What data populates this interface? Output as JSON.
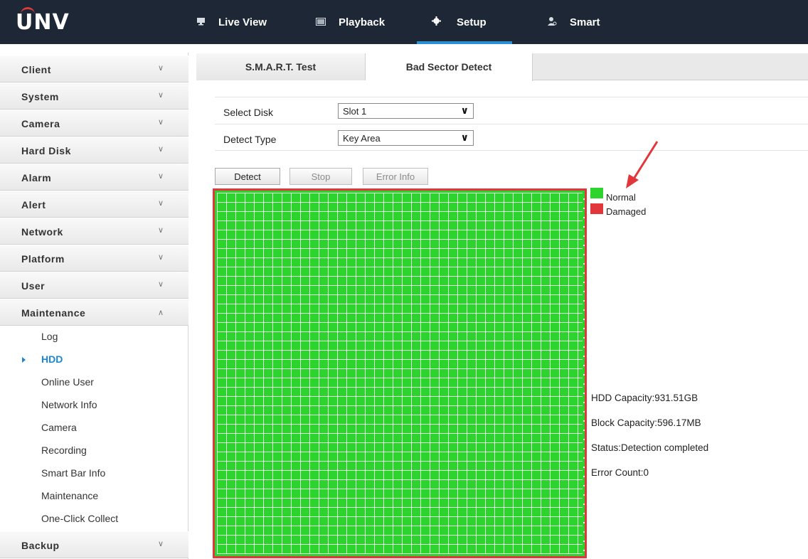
{
  "brand": {
    "logo": "UNV"
  },
  "nav": [
    {
      "icon": "monitor-icon",
      "label": "Live View"
    },
    {
      "icon": "film-icon",
      "label": "Playback"
    },
    {
      "icon": "gear-icon",
      "label": "Setup",
      "active": true
    },
    {
      "icon": "user-icon",
      "label": "Smart"
    }
  ],
  "sidebar": {
    "menus": [
      {
        "label": "Client"
      },
      {
        "label": "System"
      },
      {
        "label": "Camera"
      },
      {
        "label": "Hard Disk"
      },
      {
        "label": "Alarm"
      },
      {
        "label": "Alert"
      },
      {
        "label": "Network"
      },
      {
        "label": "Platform"
      },
      {
        "label": "User"
      },
      {
        "label": "Maintenance",
        "expanded": true
      },
      {
        "label": "Backup"
      }
    ],
    "maintenance_items": [
      "Log",
      "HDD",
      "Online User",
      "Network Info",
      "Camera",
      "Recording",
      "Smart Bar Info",
      "Maintenance",
      "One-Click Collect"
    ],
    "active_item": "HDD"
  },
  "tabs": [
    {
      "label": "S.M.A.R.T. Test"
    },
    {
      "label": "Bad Sector Detect",
      "active": true
    }
  ],
  "form": {
    "select_disk": {
      "label": "Select Disk",
      "value": "Slot 1"
    },
    "detect_type": {
      "label": "Detect Type",
      "value": "Key Area"
    }
  },
  "buttons": {
    "detect": "Detect",
    "stop": "Stop",
    "error_info": "Error Info"
  },
  "legend": [
    {
      "label": "Normal",
      "color": "#2ed42e"
    },
    {
      "label": "Damaged",
      "color": "#e2373a"
    }
  ],
  "info": {
    "hdd_capacity": "HDD Capacity:931.51GB",
    "block_capacity": "Block Capacity:596.17MB",
    "status": "Status:Detection completed",
    "error_count": "Error Count:0"
  },
  "colors": {
    "topbar": "#1d2736",
    "accent": "#2a8fd3",
    "highlight_border": "#e2373a"
  }
}
